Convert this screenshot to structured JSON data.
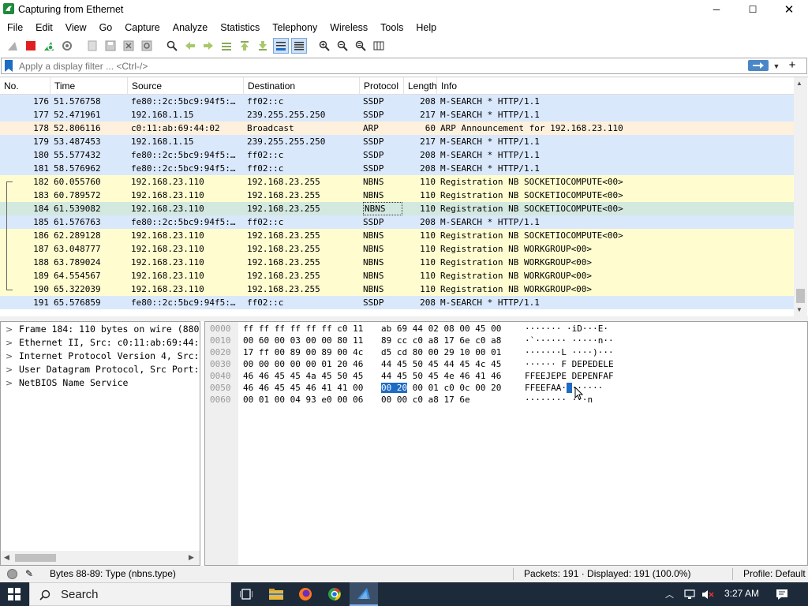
{
  "window": {
    "title": "Capturing from Ethernet",
    "minimize": "─",
    "maximize": "☐",
    "close": "✕"
  },
  "menu": [
    "File",
    "Edit",
    "View",
    "Go",
    "Capture",
    "Analyze",
    "Statistics",
    "Telephony",
    "Wireless",
    "Tools",
    "Help"
  ],
  "filter": {
    "placeholder": "Apply a display filter ... <Ctrl-/>",
    "add": "+"
  },
  "columns": {
    "no": "No.",
    "time": "Time",
    "source": "Source",
    "destination": "Destination",
    "protocol": "Protocol",
    "length": "Length",
    "info": "Info"
  },
  "packets": [
    {
      "no": "176",
      "time": "51.576758",
      "source": "fe80::2c:5bc9:94f5:…",
      "destination": "ff02::c",
      "protocol": "SSDP",
      "length": "208",
      "info": "M-SEARCH * HTTP/1.1",
      "color": "blue"
    },
    {
      "no": "177",
      "time": "52.471961",
      "source": "192.168.1.15",
      "destination": "239.255.255.250",
      "protocol": "SSDP",
      "length": "217",
      "info": "M-SEARCH * HTTP/1.1",
      "color": "blue"
    },
    {
      "no": "178",
      "time": "52.806116",
      "source": "c0:11:ab:69:44:02",
      "destination": "Broadcast",
      "protocol": "ARP",
      "length": "60",
      "info": "ARP Announcement for 192.168.23.110",
      "color": "orange"
    },
    {
      "no": "179",
      "time": "53.487453",
      "source": "192.168.1.15",
      "destination": "239.255.255.250",
      "protocol": "SSDP",
      "length": "217",
      "info": "M-SEARCH * HTTP/1.1",
      "color": "blue"
    },
    {
      "no": "180",
      "time": "55.577432",
      "source": "fe80::2c:5bc9:94f5:…",
      "destination": "ff02::c",
      "protocol": "SSDP",
      "length": "208",
      "info": "M-SEARCH * HTTP/1.1",
      "color": "blue"
    },
    {
      "no": "181",
      "time": "58.576962",
      "source": "fe80::2c:5bc9:94f5:…",
      "destination": "ff02::c",
      "protocol": "SSDP",
      "length": "208",
      "info": "M-SEARCH * HTTP/1.1",
      "color": "blue"
    },
    {
      "no": "182",
      "time": "60.055760",
      "source": "192.168.23.110",
      "destination": "192.168.23.255",
      "protocol": "NBNS",
      "length": "110",
      "info": "Registration NB SOCKETIOCOMPUTE<00>",
      "color": "yellow"
    },
    {
      "no": "183",
      "time": "60.789572",
      "source": "192.168.23.110",
      "destination": "192.168.23.255",
      "protocol": "NBNS",
      "length": "110",
      "info": "Registration NB SOCKETIOCOMPUTE<00>",
      "color": "yellow"
    },
    {
      "no": "184",
      "time": "61.539082",
      "source": "192.168.23.110",
      "destination": "192.168.23.255",
      "protocol": "NBNS",
      "length": "110",
      "info": "Registration NB SOCKETIOCOMPUTE<00>",
      "color": "green"
    },
    {
      "no": "185",
      "time": "61.576763",
      "source": "fe80::2c:5bc9:94f5:…",
      "destination": "ff02::c",
      "protocol": "SSDP",
      "length": "208",
      "info": "M-SEARCH * HTTP/1.1",
      "color": "blue"
    },
    {
      "no": "186",
      "time": "62.289128",
      "source": "192.168.23.110",
      "destination": "192.168.23.255",
      "protocol": "NBNS",
      "length": "110",
      "info": "Registration NB SOCKETIOCOMPUTE<00>",
      "color": "yellow"
    },
    {
      "no": "187",
      "time": "63.048777",
      "source": "192.168.23.110",
      "destination": "192.168.23.255",
      "protocol": "NBNS",
      "length": "110",
      "info": "Registration NB WORKGROUP<00>",
      "color": "yellow"
    },
    {
      "no": "188",
      "time": "63.789024",
      "source": "192.168.23.110",
      "destination": "192.168.23.255",
      "protocol": "NBNS",
      "length": "110",
      "info": "Registration NB WORKGROUP<00>",
      "color": "yellow"
    },
    {
      "no": "189",
      "time": "64.554567",
      "source": "192.168.23.110",
      "destination": "192.168.23.255",
      "protocol": "NBNS",
      "length": "110",
      "info": "Registration NB WORKGROUP<00>",
      "color": "yellow"
    },
    {
      "no": "190",
      "time": "65.322039",
      "source": "192.168.23.110",
      "destination": "192.168.23.255",
      "protocol": "NBNS",
      "length": "110",
      "info": "Registration NB WORKGROUP<00>",
      "color": "yellow"
    },
    {
      "no": "191",
      "time": "65.576859",
      "source": "fe80::2c:5bc9:94f5:…",
      "destination": "ff02::c",
      "protocol": "SSDP",
      "length": "208",
      "info": "M-SEARCH * HTTP/1.1",
      "color": "blue"
    }
  ],
  "details": [
    "Frame 184: 110 bytes on wire (880",
    "Ethernet II, Src: c0:11:ab:69:44:",
    "Internet Protocol Version 4, Src:",
    "User Datagram Protocol, Src Port:",
    "NetBIOS Name Service"
  ],
  "hexdump": [
    {
      "offset": "0000",
      "hex1": "ff ff ff ff ff ff c0 11",
      "hex2": "ab 69 44 02 08 00 45 00",
      "ascii": "······· ·iD···E·"
    },
    {
      "offset": "0010",
      "hex1": "00 60 00 03 00 00 80 11",
      "hex2": "89 cc c0 a8 17 6e c0 a8",
      "ascii": "·`······ ·····n··"
    },
    {
      "offset": "0020",
      "hex1": "17 ff 00 89 00 89 00 4c",
      "hex2": "d5 cd 80 00 29 10 00 01",
      "ascii": "·······L ····)···"
    },
    {
      "offset": "0030",
      "hex1": "00 00 00 00 00 01 20 46",
      "hex2": "44 45 50 45 44 45 4c 45",
      "ascii": "······ F DEPEDELE"
    },
    {
      "offset": "0040",
      "hex1": "46 46 45 45 4a 45 50 45",
      "hex2": "44 45 50 45 4e 46 41 46",
      "ascii": "FFEEJEPE DEPENFAF"
    },
    {
      "offset": "0050",
      "hex1": "46 46 45 45 46 41 41 00",
      "hex2a": "00 20",
      "hex2b": " 00 01 c0 0c 00 20",
      "ascii": "FFEEFAA·",
      "ascii_hl": " ",
      "ascii_rest": "······"
    },
    {
      "offset": "0060",
      "hex1": "00 01 00 04 93 e0 00 06",
      "hex2": "00 00 c0 a8 17 6e",
      "ascii": "········ ···n"
    }
  ],
  "status": {
    "field": "Bytes 88-89: Type (nbns.type)",
    "packets": "Packets: 191 · Displayed: 191 (100.0%)",
    "profile": "Profile: Default"
  },
  "taskbar": {
    "search": "Search",
    "time": "3:27 AM"
  },
  "colors": {
    "blue": "#dae8fc",
    "orange": "#fdf0dc",
    "yellow": "#fffdd0",
    "green": "#d3e8df",
    "accent": "#1e6bc4"
  }
}
